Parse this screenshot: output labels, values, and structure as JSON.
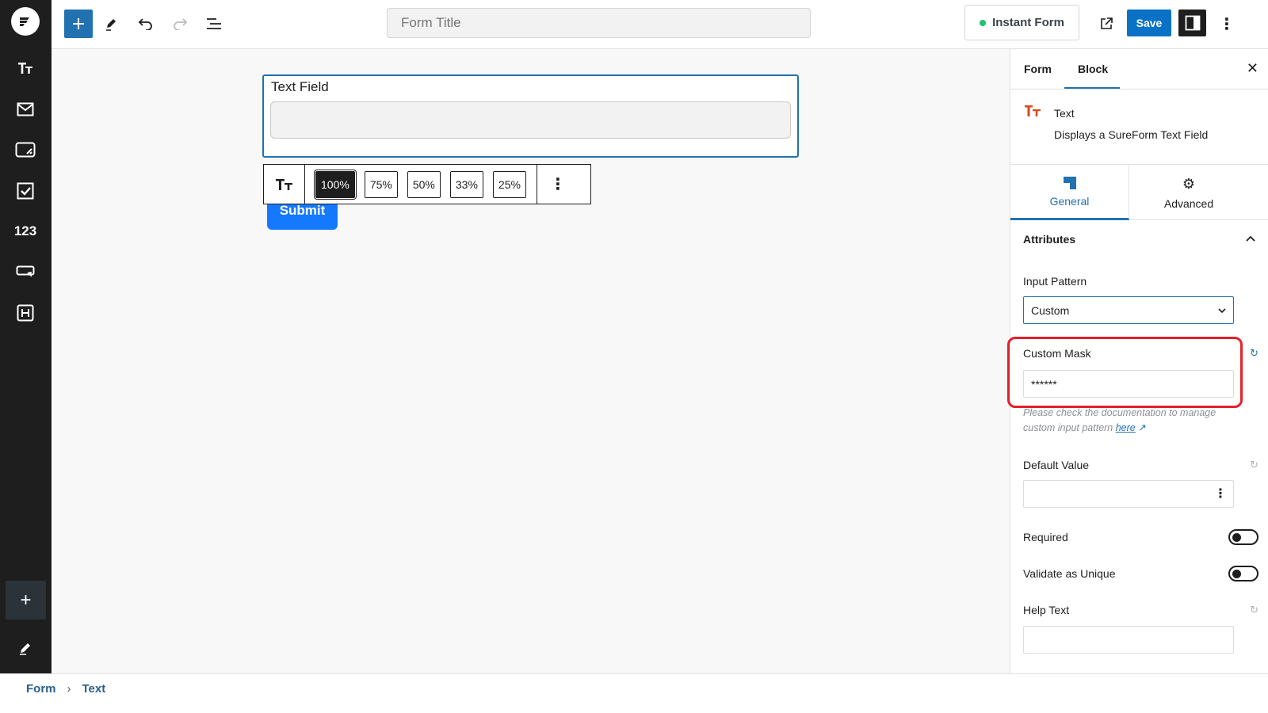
{
  "toolbar": {
    "form_title_placeholder": "Form Title",
    "instant_form_label": "Instant Form",
    "save_label": "Save"
  },
  "sidebar": {
    "items": [
      {
        "icon": "text-type-icon",
        "label": "Tт"
      },
      {
        "icon": "email-icon"
      },
      {
        "icon": "textarea-icon"
      },
      {
        "icon": "checkbox-icon"
      },
      {
        "icon": "number-icon",
        "label": "123"
      },
      {
        "icon": "dropdown-icon"
      },
      {
        "icon": "heading-icon"
      }
    ],
    "add_label": "+"
  },
  "canvas": {
    "field_label": "Text Field",
    "widths": [
      "100%",
      "75%",
      "50%",
      "33%",
      "25%"
    ],
    "active_width": "100%",
    "submit_label": "Submit"
  },
  "panel": {
    "tabs": [
      "Form",
      "Block"
    ],
    "active_tab": "Block",
    "block_title": "Text",
    "block_desc": "Displays a SureForm Text Field",
    "sub_tabs": [
      "General",
      "Advanced"
    ],
    "attributes_label": "Attributes",
    "input_pattern_label": "Input Pattern",
    "input_pattern_value": "Custom",
    "custom_mask_label": "Custom Mask",
    "custom_mask_value": "******",
    "help_text_prefix": "Please check the documentation to manage custom input pattern ",
    "help_link": "here",
    "default_value_label": "Default Value",
    "required_label": "Required",
    "validate_label": "Validate as Unique",
    "help_text_label": "Help Text"
  },
  "breadcrumb": [
    "Form",
    "Text"
  ],
  "colors": {
    "accent": "#2271b1",
    "submit": "#1479ff",
    "highlight": "#e3212b",
    "sidebar": "#1e1e1e"
  }
}
